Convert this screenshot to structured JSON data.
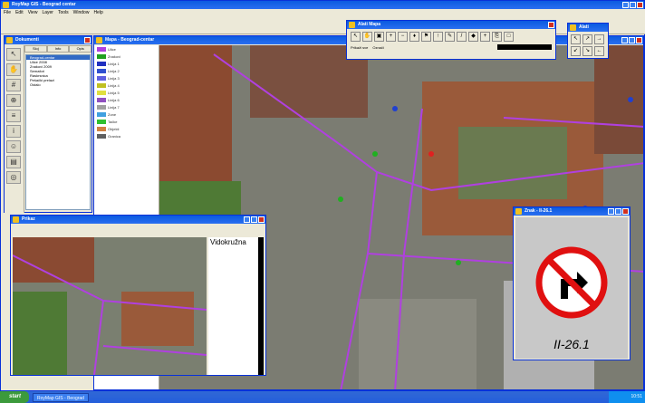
{
  "app": {
    "title": "RoyMap GIS - Beograd centar",
    "menu": [
      "File",
      "Edit",
      "View",
      "Layer",
      "Tools",
      "Window",
      "Help"
    ]
  },
  "left_panel": {
    "title": "Dokumenti",
    "tabs": [
      "Sloj",
      "Info",
      "Opis"
    ],
    "tree": [
      "Beograd-centar",
      "Ulice 2008",
      "Znakovi 2009",
      "Semafori",
      "Raskrsnica",
      "Pešački prelazi",
      "Ostalo"
    ]
  },
  "map_window": {
    "title": "Mapa - Beograd-centar",
    "legend": [
      "Ulice",
      "Znakovi",
      "Linija 1",
      "Linija 2",
      "Linija 3",
      "Linija 4",
      "Linija 5",
      "Linija 6",
      "Linija 7",
      "Zone",
      "Tačke",
      "Objekti",
      "Granica"
    ]
  },
  "tool_window": {
    "title": "Alati Mapa",
    "opt1": "Prikaži sve",
    "opt2": "Označi"
  },
  "mini_window": {
    "title": "Alati"
  },
  "info_window": {
    "title": "Prikaz",
    "heading": "Vidokružna"
  },
  "sign_window": {
    "title": "Znak - II-26.1",
    "code": "II-26.1"
  },
  "taskbar": {
    "start": "start",
    "task": "RoyMap GIS - Beograd",
    "clock": "10:51"
  },
  "colors": {
    "route": "#b040e0",
    "sign_red": "#e01010",
    "sign_blue": "#1040c0"
  }
}
